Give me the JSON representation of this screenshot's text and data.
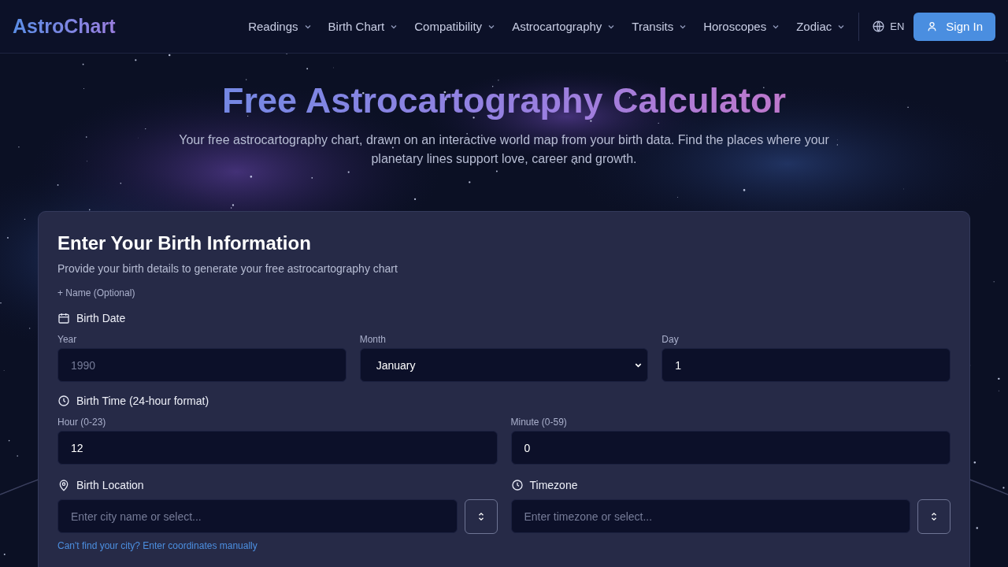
{
  "logo": "AstroChart",
  "nav": [
    {
      "label": "Readings"
    },
    {
      "label": "Birth Chart"
    },
    {
      "label": "Compatibility"
    },
    {
      "label": "Astrocartography"
    },
    {
      "label": "Transits"
    },
    {
      "label": "Horoscopes"
    },
    {
      "label": "Zodiac"
    }
  ],
  "language": "EN",
  "sign_in": "Sign In",
  "hero": {
    "title": "Free Astrocartography Calculator",
    "subtitle": "Your free astrocartography chart, drawn on an interactive world map from your birth data. Find the places where your planetary lines support love, career and growth."
  },
  "form": {
    "title": "Enter Your Birth Information",
    "subtitle": "Provide your birth details to generate your free astrocartography chart",
    "name_toggle": "+ Name (Optional)",
    "sections": [
      {
        "kind": "date",
        "label": "Birth Date",
        "fields": [
          {
            "kind": "input",
            "label": "Year",
            "placeholder": "1990"
          },
          {
            "kind": "select",
            "label": "Month",
            "value": "January"
          },
          {
            "kind": "input",
            "label": "Day",
            "value": "1"
          }
        ]
      },
      {
        "kind": "time",
        "label": "Birth Time (24-hour format)",
        "fields": [
          {
            "kind": "input",
            "label": "Hour (0-23)",
            "value": "12"
          },
          {
            "kind": "input",
            "label": "Minute (0-59)",
            "value": "0"
          }
        ]
      }
    ],
    "pickers": [
      {
        "kind": "location",
        "label": "Birth Location",
        "placeholder": "Enter city name or select...",
        "link": "Can't find your city? Enter coordinates manually"
      },
      {
        "kind": "time",
        "label": "Timezone",
        "placeholder": "Enter timezone or select..."
      }
    ]
  }
}
